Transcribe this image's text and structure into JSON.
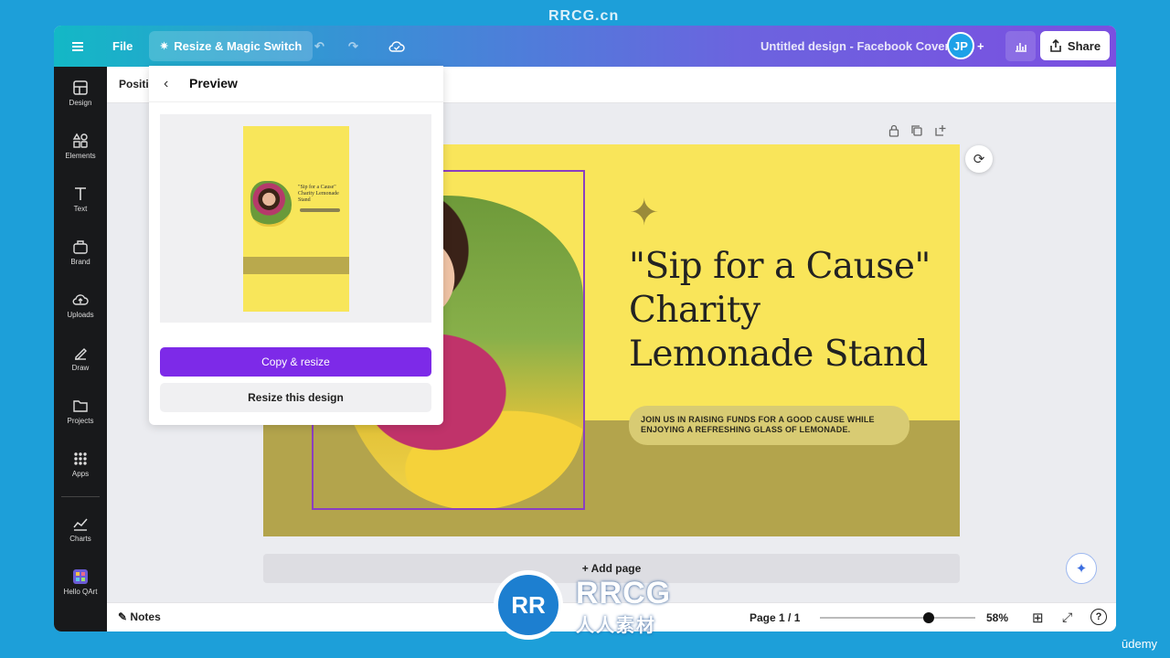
{
  "watermark": {
    "top": "RRCG.cn",
    "logo_main": "RRCG",
    "logo_sub": "人人素材",
    "logo_mark": "RR",
    "corner": "ūdemy"
  },
  "topbar": {
    "file": "File",
    "magic_switch": "Resize & Magic Switch",
    "doc_title": "Untitled design - Facebook Cover",
    "avatar": "JP",
    "share": "Share"
  },
  "rail": [
    {
      "label": "Design",
      "icon": "design-icon"
    },
    {
      "label": "Elements",
      "icon": "elements-icon"
    },
    {
      "label": "Text",
      "icon": "text-icon"
    },
    {
      "label": "Brand",
      "icon": "brand-icon"
    },
    {
      "label": "Uploads",
      "icon": "uploads-icon"
    },
    {
      "label": "Draw",
      "icon": "draw-icon"
    },
    {
      "label": "Projects",
      "icon": "projects-icon"
    },
    {
      "label": "Apps",
      "icon": "apps-icon"
    },
    {
      "label": "Charts",
      "icon": "charts-icon"
    },
    {
      "label": "Hello QArt",
      "icon": "hello-qart-icon"
    }
  ],
  "ctxbar": {
    "position": "Positio"
  },
  "preview": {
    "title": "Preview",
    "mini_text": "\"Sip for a Cause\" Charity Lemonade Stand",
    "copy_resize": "Copy & resize",
    "resize_design": "Resize this design"
  },
  "design": {
    "headline": "\"Sip for a Cause\" Charity Lemonade Stand",
    "subtext": "JOIN US IN RAISING FUNDS FOR A GOOD CAUSE WHILE ENJOYING A REFRESHING GLASS OF LEMONADE.",
    "colors": {
      "background": "#f9e55a",
      "band": "#b3a44c",
      "selection": "#8b3fbf"
    }
  },
  "add_page": "+ Add page",
  "footer": {
    "notes": "Notes",
    "page": "Page 1 / 1",
    "zoom_label": "58%",
    "zoom_fraction": 0.58
  }
}
